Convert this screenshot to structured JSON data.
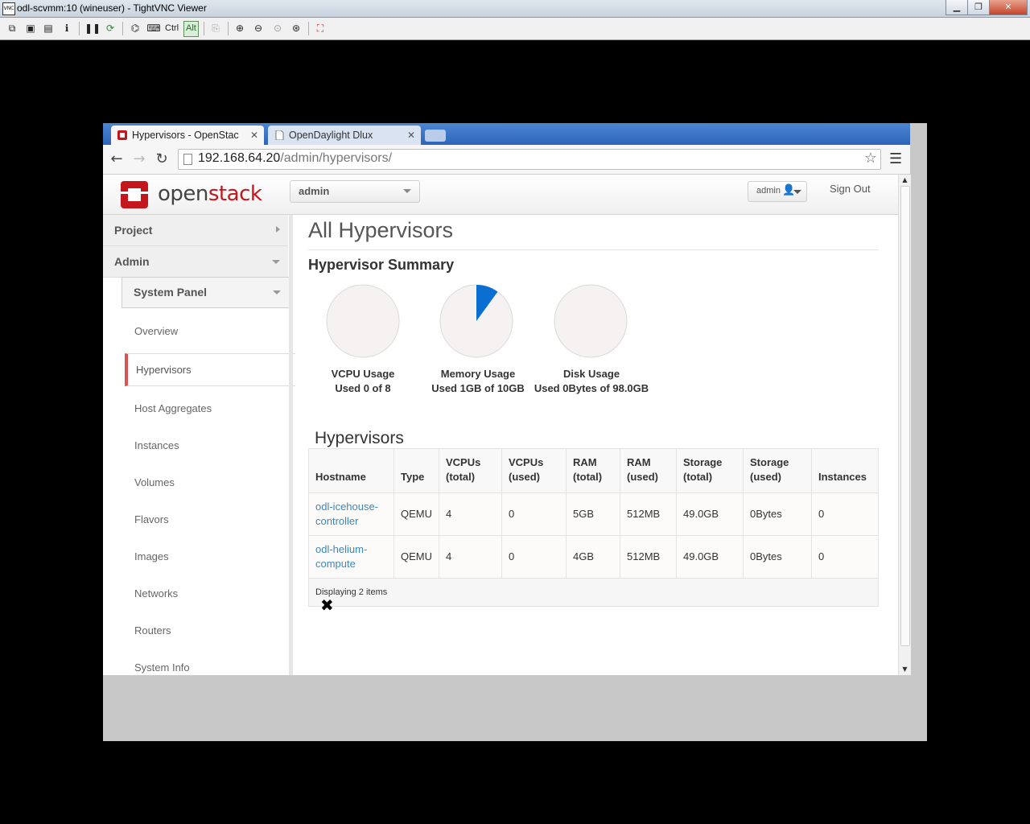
{
  "vnc": {
    "title": "odl-scvmm:10 (wineuser) - TightVNC Viewer",
    "toolbar": {
      "ctrl_label": "Ctrl",
      "alt_label": "Alt"
    }
  },
  "browser": {
    "tabs": [
      {
        "label": "Hypervisors - OpenStac"
      },
      {
        "label": "OpenDaylight Dlux"
      }
    ],
    "url_host": "192.168.64.20",
    "url_path": "/admin/hypervisors/"
  },
  "header": {
    "logo_open": "open",
    "logo_stack": "stack",
    "project_select": "admin",
    "user_menu": "admin",
    "sign_out": "Sign Out"
  },
  "sidebar": {
    "project": "Project",
    "admin": "Admin",
    "system_panel": "System Panel",
    "items": [
      {
        "label": "Overview"
      },
      {
        "label": "Hypervisors"
      },
      {
        "label": "Host Aggregates"
      },
      {
        "label": "Instances"
      },
      {
        "label": "Volumes"
      },
      {
        "label": "Flavors"
      },
      {
        "label": "Images"
      },
      {
        "label": "Networks"
      },
      {
        "label": "Routers"
      },
      {
        "label": "System Info"
      }
    ]
  },
  "main": {
    "title": "All Hypervisors",
    "summary_title": "Hypervisor Summary",
    "pies": [
      {
        "label": "VCPU Usage",
        "detail": "Used 0 of 8",
        "fraction": 0.0
      },
      {
        "label": "Memory Usage",
        "detail": "Used 1GB of 10GB",
        "fraction": 0.1
      },
      {
        "label": "Disk Usage",
        "detail": "Used 0Bytes of 98.0GB",
        "fraction": 0.0
      }
    ],
    "hypervisors_title": "Hypervisors",
    "table": {
      "headers": [
        [
          "Hostname"
        ],
        [
          "Type"
        ],
        [
          "VCPUs",
          "(total)"
        ],
        [
          "VCPUs",
          "(used)"
        ],
        [
          "RAM",
          "(total)"
        ],
        [
          "RAM",
          "(used)"
        ],
        [
          "Storage",
          "(total)"
        ],
        [
          "Storage",
          "(used)"
        ],
        [
          "Instances"
        ]
      ],
      "rows": [
        {
          "hostname": [
            "odl-icehouse-",
            "controller"
          ],
          "type": "QEMU",
          "vcpus_total": "4",
          "vcpus_used": "0",
          "ram_total": "5GB",
          "ram_used": "512MB",
          "storage_total": "49.0GB",
          "storage_used": "0Bytes",
          "instances": "0"
        },
        {
          "hostname": [
            "odl-helium-",
            "compute"
          ],
          "type": "QEMU",
          "vcpus_total": "4",
          "vcpus_used": "0",
          "ram_total": "4GB",
          "ram_used": "512MB",
          "storage_total": "49.0GB",
          "storage_used": "0Bytes",
          "instances": "0"
        }
      ],
      "footer": "Displaying 2 items"
    },
    "close_glyph": "✖"
  },
  "colors": {
    "accent_red": "#c4161c",
    "pie_fill": "#0a6fd0",
    "link": "#3f86b8",
    "active_border": "#d9534f"
  },
  "icons": [
    "back-icon",
    "forward-icon",
    "reload-icon",
    "star-icon",
    "menu-icon",
    "user-icon",
    "close-icon"
  ]
}
